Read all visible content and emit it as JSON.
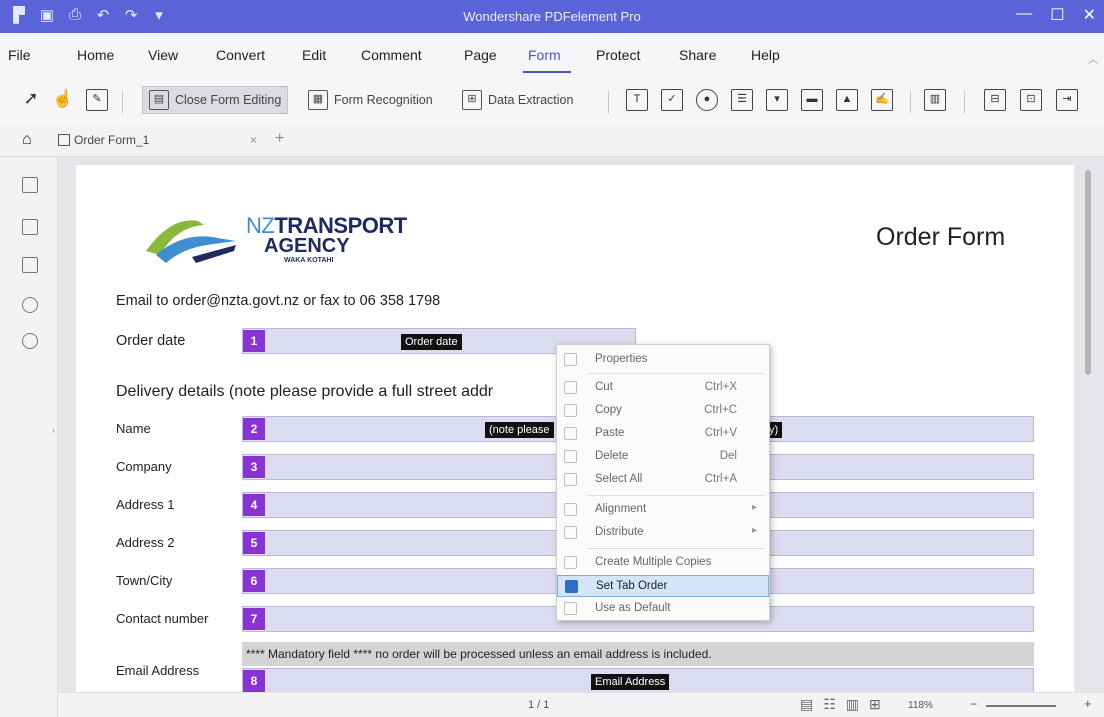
{
  "app": {
    "title": "Wondershare PDFelement Pro",
    "quick_access": [
      "▛",
      "▣",
      "⎙",
      "↶",
      "↷",
      "▾"
    ],
    "window_controls": [
      "—",
      "☐",
      "✕"
    ]
  },
  "menu": {
    "items": [
      "File",
      "Home",
      "View",
      "Convert",
      "Edit",
      "Comment",
      "Page",
      "Form",
      "Protect",
      "Share",
      "Help"
    ],
    "active": "Form"
  },
  "toolbar": {
    "close_form_editing": "Close Form Editing",
    "form_recognition": "Form Recognition",
    "data_extraction": "Data Extraction",
    "field_icons": [
      "text-field-icon",
      "checkbox-icon",
      "radio-button-icon",
      "list-box-icon",
      "combo-box-icon",
      "button-icon",
      "image-field-icon",
      "signature-icon",
      "barcode-icon",
      "align-icon",
      "form-data-icon",
      "export-icon"
    ]
  },
  "tabs": {
    "document": "Order Form_1",
    "close": "×",
    "add": "+"
  },
  "document": {
    "logo": {
      "nz": "NZ",
      "transport": "TRANSPORT",
      "agency": "AGENCY",
      "subtitle": "WAKA KOTAHI"
    },
    "title": "Order Form",
    "email_line": "Email to order@nzta.govt.nz or fax to 06 358 1798",
    "order_date_label": "Order date",
    "order_date_field": {
      "number": "1",
      "tag": "Order date"
    },
    "delivery_heading": "Delivery details (note please provide a full street addr",
    "fields": [
      {
        "label": "Name",
        "number": "2",
        "tag": "(note please",
        "tag2": "y)"
      },
      {
        "label": "Company",
        "number": "3"
      },
      {
        "label": "Address 1",
        "number": "4"
      },
      {
        "label": "Address 2",
        "number": "5"
      },
      {
        "label": "Town/City",
        "number": "6"
      },
      {
        "label": "Contact number",
        "number": "7"
      }
    ],
    "mandatory_note": "**** Mandatory field **** no order will be processed unless an email address is included.",
    "email_label": "Email Address",
    "email_field": {
      "number": "8",
      "tag": "Email Address"
    }
  },
  "context_menu": {
    "items": [
      {
        "label": "Properties",
        "shortcut": ""
      },
      {
        "label": "Cut",
        "shortcut": "Ctrl+X"
      },
      {
        "label": "Copy",
        "shortcut": "Ctrl+C"
      },
      {
        "label": "Paste",
        "shortcut": "Ctrl+V"
      },
      {
        "label": "Delete",
        "shortcut": "Del"
      },
      {
        "label": "Select All",
        "shortcut": "Ctrl+A"
      },
      {
        "label": "Alignment",
        "shortcut": ""
      },
      {
        "label": "Distribute",
        "shortcut": ""
      },
      {
        "label": "Create Multiple Copies",
        "shortcut": ""
      },
      {
        "label": "Set Tab Order",
        "shortcut": ""
      },
      {
        "label": "Use as Default",
        "shortcut": ""
      }
    ],
    "highlighted": "Set Tab Order"
  },
  "status": {
    "page": "1 / 1",
    "zoom": "118%",
    "zoom_minus": "−",
    "zoom_plus": "+"
  },
  "colors": {
    "titlebar": "#5b63d8",
    "accent": "#4a52c6",
    "field_number": "#8a33d4",
    "field_bg": "#dcdcf0",
    "menu_highlight": "#d3e6f7"
  }
}
